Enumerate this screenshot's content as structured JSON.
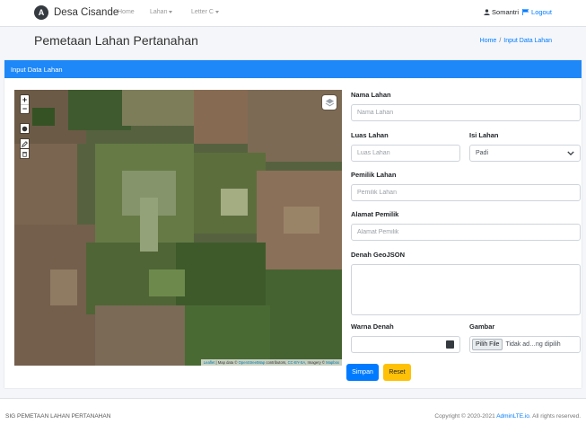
{
  "navbar": {
    "brand": "Desa Cisande",
    "links": [
      "Home",
      "Lahan",
      "Letter C"
    ],
    "user_name": "Somantri",
    "logout": "Logout"
  },
  "header": {
    "title": "Pemetaan Lahan Pertanahan",
    "breadcrumb": {
      "home": "Home",
      "separator": "/",
      "active": "Input Data Lahan"
    }
  },
  "card": {
    "title": "Input Data Lahan"
  },
  "map": {
    "zoom_in": "+",
    "zoom_out": "−",
    "attribution": {
      "leaflet": "Leaflet",
      "sep": " | Map data © ",
      "osm": "OpenStreetMap",
      "mid": " contributors, ",
      "license": "CC-BY-SA",
      "end": ", Imagery © ",
      "provider": "Mapbox"
    }
  },
  "form": {
    "nama_lahan": {
      "label": "Nama Lahan",
      "placeholder": "Nama Lahan"
    },
    "luas_lahan": {
      "label": "Luas Lahan",
      "placeholder": "Luas Lahan"
    },
    "isi_lahan": {
      "label": "Isi Lahan",
      "value": "Padi"
    },
    "pemilik_lahan": {
      "label": "Pemilik Lahan",
      "placeholder": "Pemilik Lahan"
    },
    "alamat_pemilik": {
      "label": "Alamat Pemilik",
      "placeholder": "Alamat Pemilik"
    },
    "denah_geojson": {
      "label": "Denah GeoJSON"
    },
    "warna_denah": {
      "label": "Warna Denah"
    },
    "gambar": {
      "label": "Gambar",
      "button": "Pilih File",
      "status": "Tidak ad…ng dipilih"
    },
    "submit": "Simpan",
    "reset": "Reset"
  },
  "footer": {
    "left": "SIG PEMETAAN LAHAN PERTANAHAN",
    "copyright_prefix": "Copyright © 2020-2021 ",
    "copyright_link": "AdminLTE.io",
    "copyright_suffix": ". All rights reserved."
  },
  "colors": {
    "primary": "#007bff",
    "card_header": "#1e88f8",
    "warning": "#ffc107",
    "swatch": "#343a40"
  }
}
